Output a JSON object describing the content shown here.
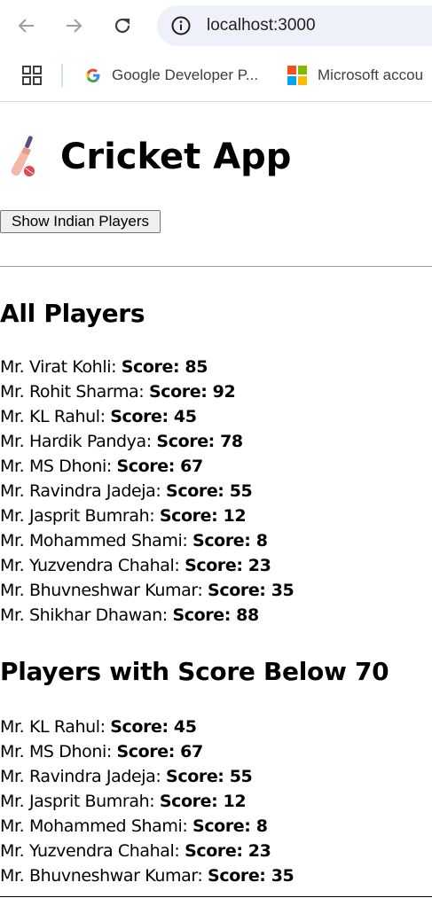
{
  "browser": {
    "url": "localhost:3000",
    "bookmarks": [
      {
        "label": "Google Developer P...",
        "icon": "google-icon"
      },
      {
        "label": "Microsoft accou",
        "icon": "microsoft-icon"
      }
    ]
  },
  "app": {
    "icon": "cricket-bat-icon",
    "title": "Cricket App",
    "button_label": "Show Indian Players"
  },
  "all_players": {
    "heading": "All Players",
    "players": [
      {
        "name": "Mr. Virat Kohli: ",
        "score": "Score: 85"
      },
      {
        "name": "Mr. Rohit Sharma: ",
        "score": "Score: 92"
      },
      {
        "name": "Mr. KL Rahul: ",
        "score": "Score: 45"
      },
      {
        "name": "Mr. Hardik Pandya: ",
        "score": "Score: 78"
      },
      {
        "name": "Mr. MS Dhoni: ",
        "score": "Score: 67"
      },
      {
        "name": "Mr. Ravindra Jadeja: ",
        "score": "Score: 55"
      },
      {
        "name": "Mr. Jasprit Bumrah: ",
        "score": "Score: 12"
      },
      {
        "name": "Mr. Mohammed Shami: ",
        "score": "Score: 8"
      },
      {
        "name": "Mr. Yuzvendra Chahal: ",
        "score": "Score: 23"
      },
      {
        "name": "Mr. Bhuvneshwar Kumar: ",
        "score": "Score: 35"
      },
      {
        "name": "Mr. Shikhar Dhawan: ",
        "score": "Score: 88"
      }
    ]
  },
  "below_70": {
    "heading": "Players with Score Below 70",
    "players": [
      {
        "name": "Mr. KL Rahul: ",
        "score": "Score: 45"
      },
      {
        "name": "Mr. MS Dhoni: ",
        "score": "Score: 67"
      },
      {
        "name": "Mr. Ravindra Jadeja: ",
        "score": "Score: 55"
      },
      {
        "name": "Mr. Jasprit Bumrah: ",
        "score": "Score: 12"
      },
      {
        "name": "Mr. Mohammed Shami: ",
        "score": "Score: 8"
      },
      {
        "name": "Mr. Yuzvendra Chahal: ",
        "score": "Score: 23"
      },
      {
        "name": "Mr. Bhuvneshwar Kumar: ",
        "score": "Score: 35"
      }
    ]
  }
}
